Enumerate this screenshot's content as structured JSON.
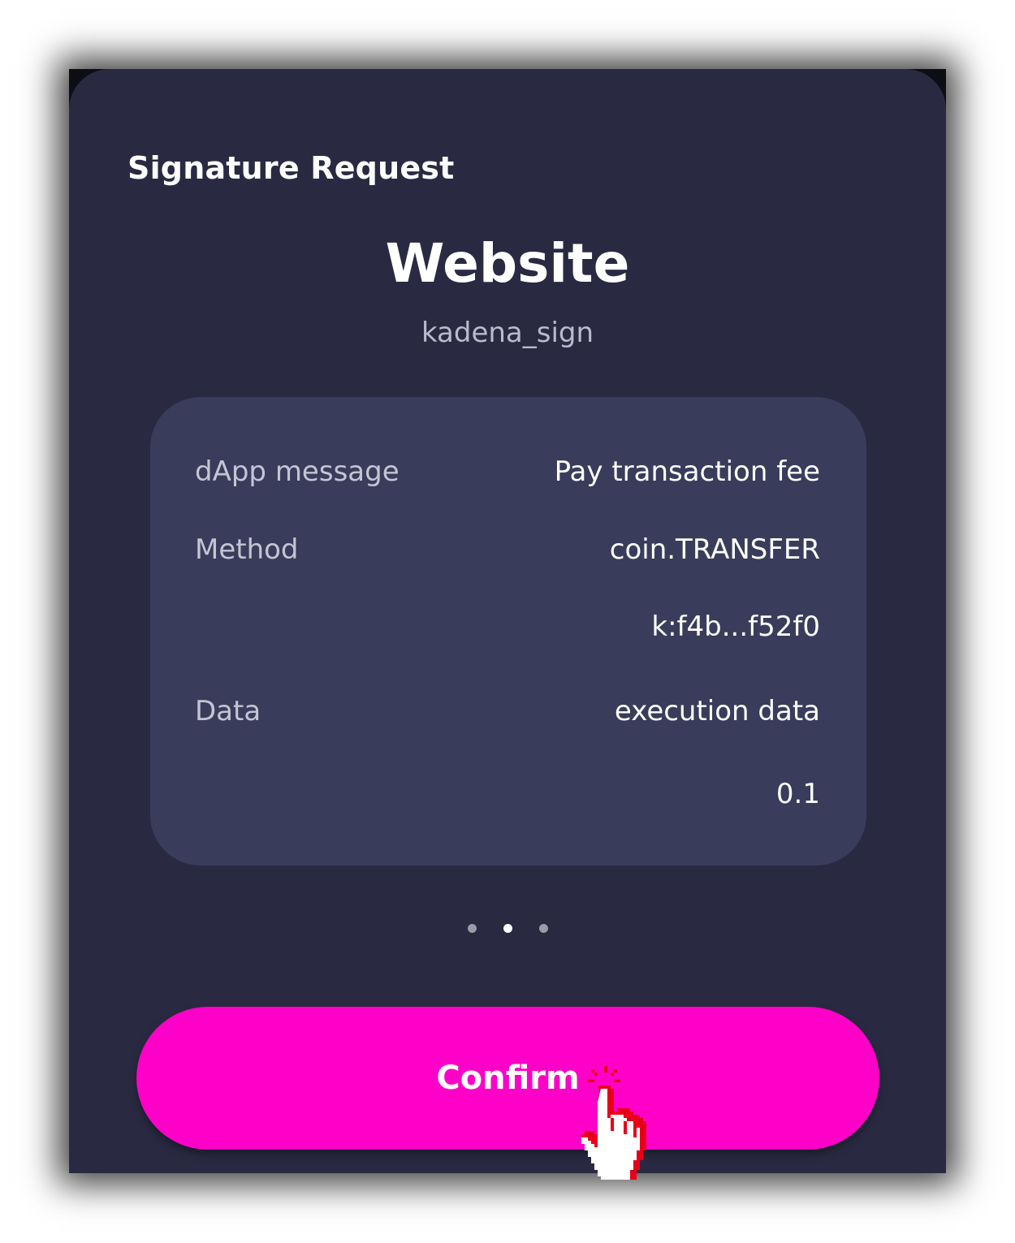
{
  "header": {
    "title": "Signature Request"
  },
  "site": {
    "name": "Website",
    "method": "kadena_sign"
  },
  "details": {
    "dapp_message_label": "dApp message",
    "dapp_message_value": "Pay transaction fee",
    "method_label": "Method",
    "method_value": "coin.TRANSFER",
    "account_value": "k:f4b...f52f0",
    "data_label": "Data",
    "data_value": "execution data",
    "amount_value": "0.1"
  },
  "pagination": {
    "count": 3,
    "active_index": 1
  },
  "actions": {
    "confirm_label": "Confirm"
  },
  "colors": {
    "panel_background": "#292a42",
    "card_background": "#3a3c5c",
    "accent": "#ff00c8",
    "cursor_outline": "#e8001a"
  },
  "icons": {
    "cursor": "pointing-hand-cursor-icon"
  }
}
